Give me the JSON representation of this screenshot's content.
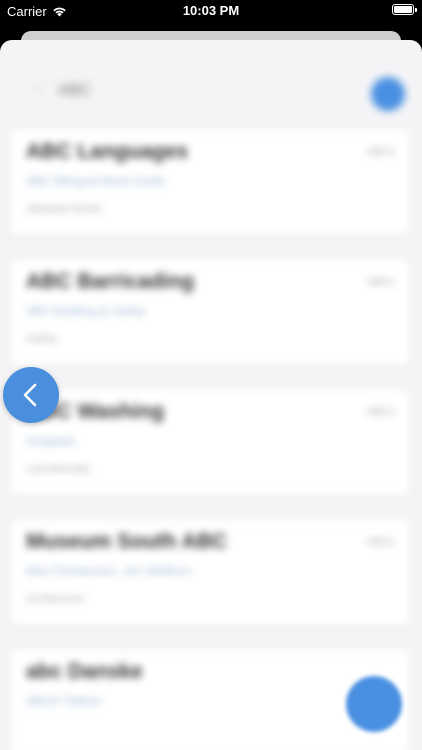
{
  "status_bar": {
    "carrier": "Carrier",
    "time": "10:03 PM"
  },
  "search": {
    "query": "ABC"
  },
  "cards": [
    {
      "title": "ABC Languages",
      "meta": "ABCs",
      "subtitle": "ABC Bilingual Book Guide",
      "tag": "Alphabet books"
    },
    {
      "title": "ABC Barricading",
      "meta": "ABCs",
      "subtitle": "ABC Building & Safety",
      "tag": "Safety"
    },
    {
      "title": "ABC Washing",
      "meta": "ABCs",
      "subtitle": "Hospitals",
      "tag": "Laundromats"
    },
    {
      "title": "Museum South ABC",
      "meta": "ABCs",
      "subtitle": "Max Christensen, Jim Stellhorn",
      "tag": "Architecture"
    },
    {
      "title": "abc Danske",
      "meta": "",
      "subtitle": "ABCD Tildkort",
      "tag": ""
    }
  ],
  "colors": {
    "accent": "#4a90e2",
    "sheet_bg": "#f4f4f6"
  },
  "icons": {
    "back_fab": "chevron-left-icon",
    "wifi": "wifi-icon",
    "battery": "battery-icon"
  }
}
